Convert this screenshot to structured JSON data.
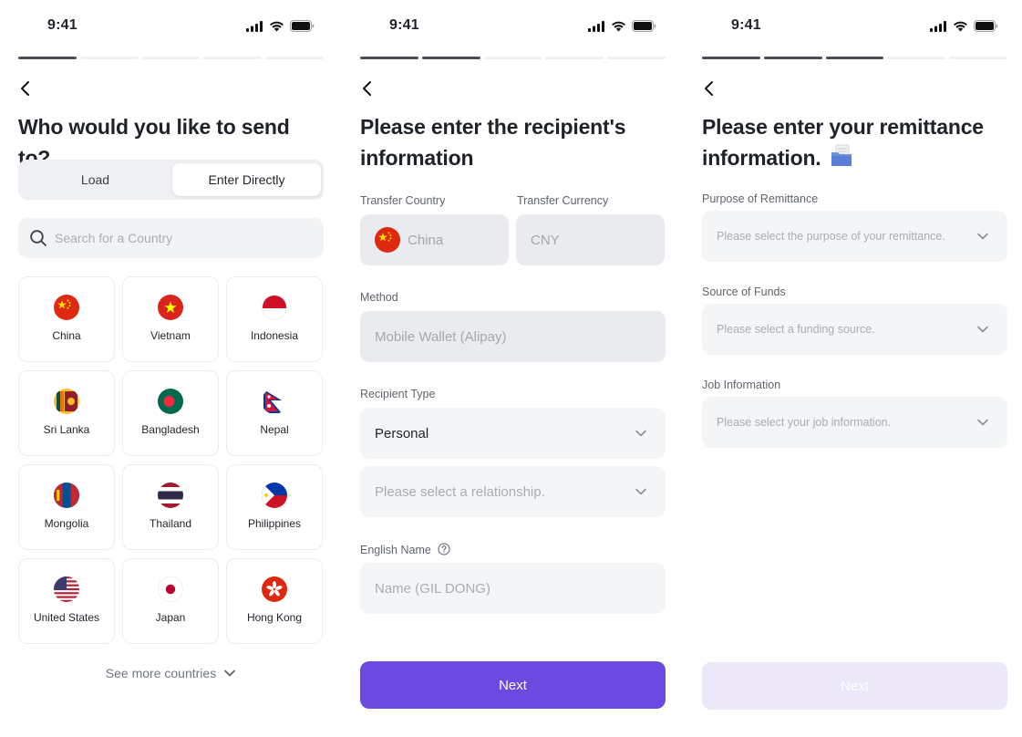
{
  "status_bar": {
    "time": "9:41"
  },
  "screen1": {
    "progress": {
      "total": 5,
      "completed": 1
    },
    "title": "Who would you like to send to?",
    "tabs": [
      {
        "label": "Load",
        "selected": false
      },
      {
        "label": "Enter Directly",
        "selected": true
      }
    ],
    "search": {
      "placeholder": "Search for a Country"
    },
    "countries": [
      {
        "name": "China",
        "flag": "china-flag"
      },
      {
        "name": "Vietnam",
        "flag": "vietnam-flag"
      },
      {
        "name": "Indonesia",
        "flag": "indonesia-flag"
      },
      {
        "name": "Sri Lanka",
        "flag": "sri-lanka-flag"
      },
      {
        "name": "Bangladesh",
        "flag": "bangladesh-flag"
      },
      {
        "name": "Nepal",
        "flag": "nepal-flag"
      },
      {
        "name": "Mongolia",
        "flag": "mongolia-flag"
      },
      {
        "name": "Thailand",
        "flag": "thailand-flag"
      },
      {
        "name": "Philippines",
        "flag": "philippines-flag"
      },
      {
        "name": "United States",
        "flag": "usa-flag"
      },
      {
        "name": "Japan",
        "flag": "japan-flag"
      },
      {
        "name": "Hong Kong",
        "flag": "hong-kong-flag"
      }
    ],
    "see_more": "See more countries"
  },
  "screen2": {
    "progress": {
      "total": 5,
      "completed": 2
    },
    "title_line1": "Please enter the recipient's",
    "title_line2": "information",
    "transfer_country": {
      "label": "Transfer Country",
      "value": "China"
    },
    "transfer_currency": {
      "label": "Transfer Currency",
      "value": "CNY"
    },
    "method": {
      "label": "Method",
      "value": "Mobile Wallet (Alipay)"
    },
    "recipient_type": {
      "label": "Recipient Type",
      "value": "Personal"
    },
    "relationship": {
      "placeholder": "Please select a relationship."
    },
    "english_name": {
      "label": "English Name",
      "placeholder": "Name (GIL DONG)"
    },
    "next": "Next"
  },
  "screen3": {
    "progress": {
      "total": 5,
      "completed": 3
    },
    "title_line1": "Please enter your remittance",
    "title_line2": "information.",
    "purpose": {
      "label": "Purpose of Remittance",
      "placeholder": "Please select the purpose of your remittance."
    },
    "source": {
      "label": "Source of Funds",
      "placeholder": "Please select a funding source."
    },
    "job": {
      "label": "Job Information",
      "placeholder": "Please select your job information."
    },
    "next": "Next"
  },
  "colors": {
    "primary": "#6b4ae0",
    "primary_disabled": "#ece8fa",
    "field_bg": "#f4f5f7",
    "progress_on": "#4a4d55"
  }
}
